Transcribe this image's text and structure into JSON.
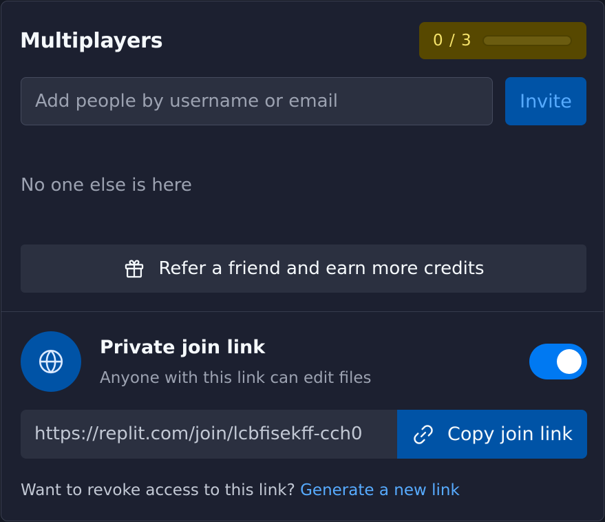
{
  "header": {
    "title": "Multiplayers",
    "usage": {
      "count_text": "0 / 3",
      "used": 0,
      "limit": 3
    }
  },
  "invite": {
    "placeholder": "Add people by username or email",
    "value": "",
    "button_label": "Invite"
  },
  "members": {
    "empty_text": "No one else is here"
  },
  "refer": {
    "label": "Refer a friend and earn more credits",
    "icon": "gift-icon"
  },
  "join_link": {
    "icon": "globe-icon",
    "title": "Private join link",
    "subtitle": "Anyone with this link can edit files",
    "enabled": true,
    "url": "https://replit.com/join/lcbfisekff-cch0",
    "copy_label": "Copy join link",
    "copy_icon": "link-icon",
    "revoke_text": "Want to revoke access to this link?",
    "revoke_link": "Generate a new link"
  },
  "colors": {
    "panel_bg": "#1c2030",
    "input_bg": "#2b3040",
    "accent": "#0079f2",
    "button_blue": "#0053a6",
    "link_blue": "#57abff",
    "usage_bg": "#574800",
    "usage_text": "#f5e36a",
    "muted_text": "#9ca2b1"
  }
}
